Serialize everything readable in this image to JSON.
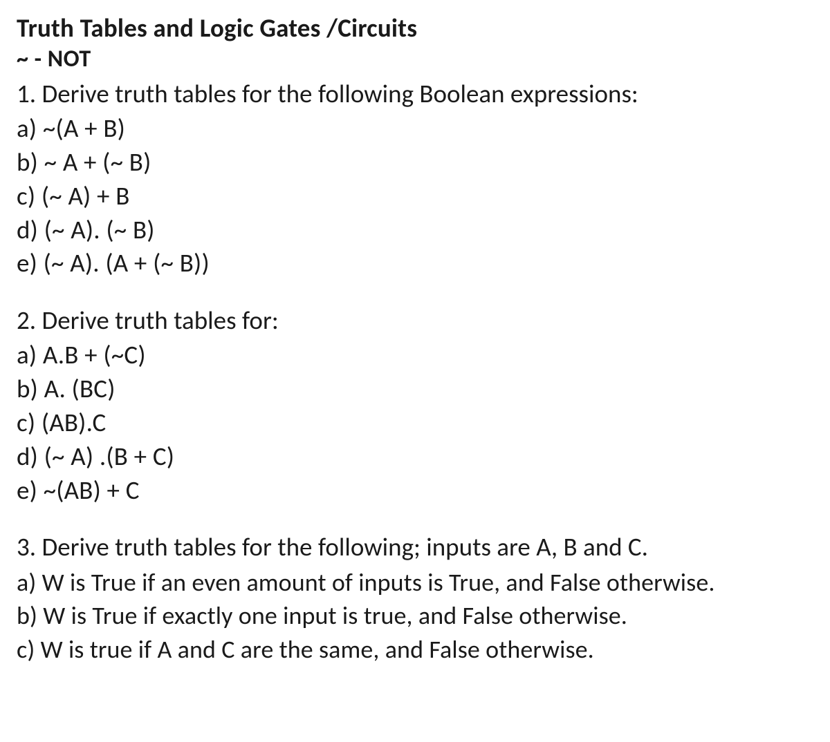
{
  "title": "Truth Tables and Logic Gates /Circuits",
  "sub_note": "~ - NOT",
  "sections": {
    "q1": {
      "heading": "1. Derive truth tables for the following Boolean expressions:",
      "items": {
        "a": "a) ~(A + B)",
        "b": "b) ~ A + (~ B)",
        "c": "c) (~ A) + B",
        "d": "d) (~ A). (~ B)",
        "e": "e) (~ A). (A + (~ B))"
      }
    },
    "q2": {
      "heading": "2. Derive truth tables for:",
      "items": {
        "a": "a) A.B + (~C)",
        "b": "b) A. (BC)",
        "c": "c) (AB).C",
        "d": "d) (~ A) .(B + C)",
        "e": "e) ~(AB) + C"
      }
    },
    "q3": {
      "heading": "3. Derive truth tables for the following; inputs are A, B and C.",
      "items": {
        "a": "a) W is True if an even amount of inputs is True, and False otherwise.",
        "b": "b) W is True if exactly one input is true, and False otherwise.",
        "c": "c) W is true if A and C are the same, and False otherwise."
      }
    }
  }
}
